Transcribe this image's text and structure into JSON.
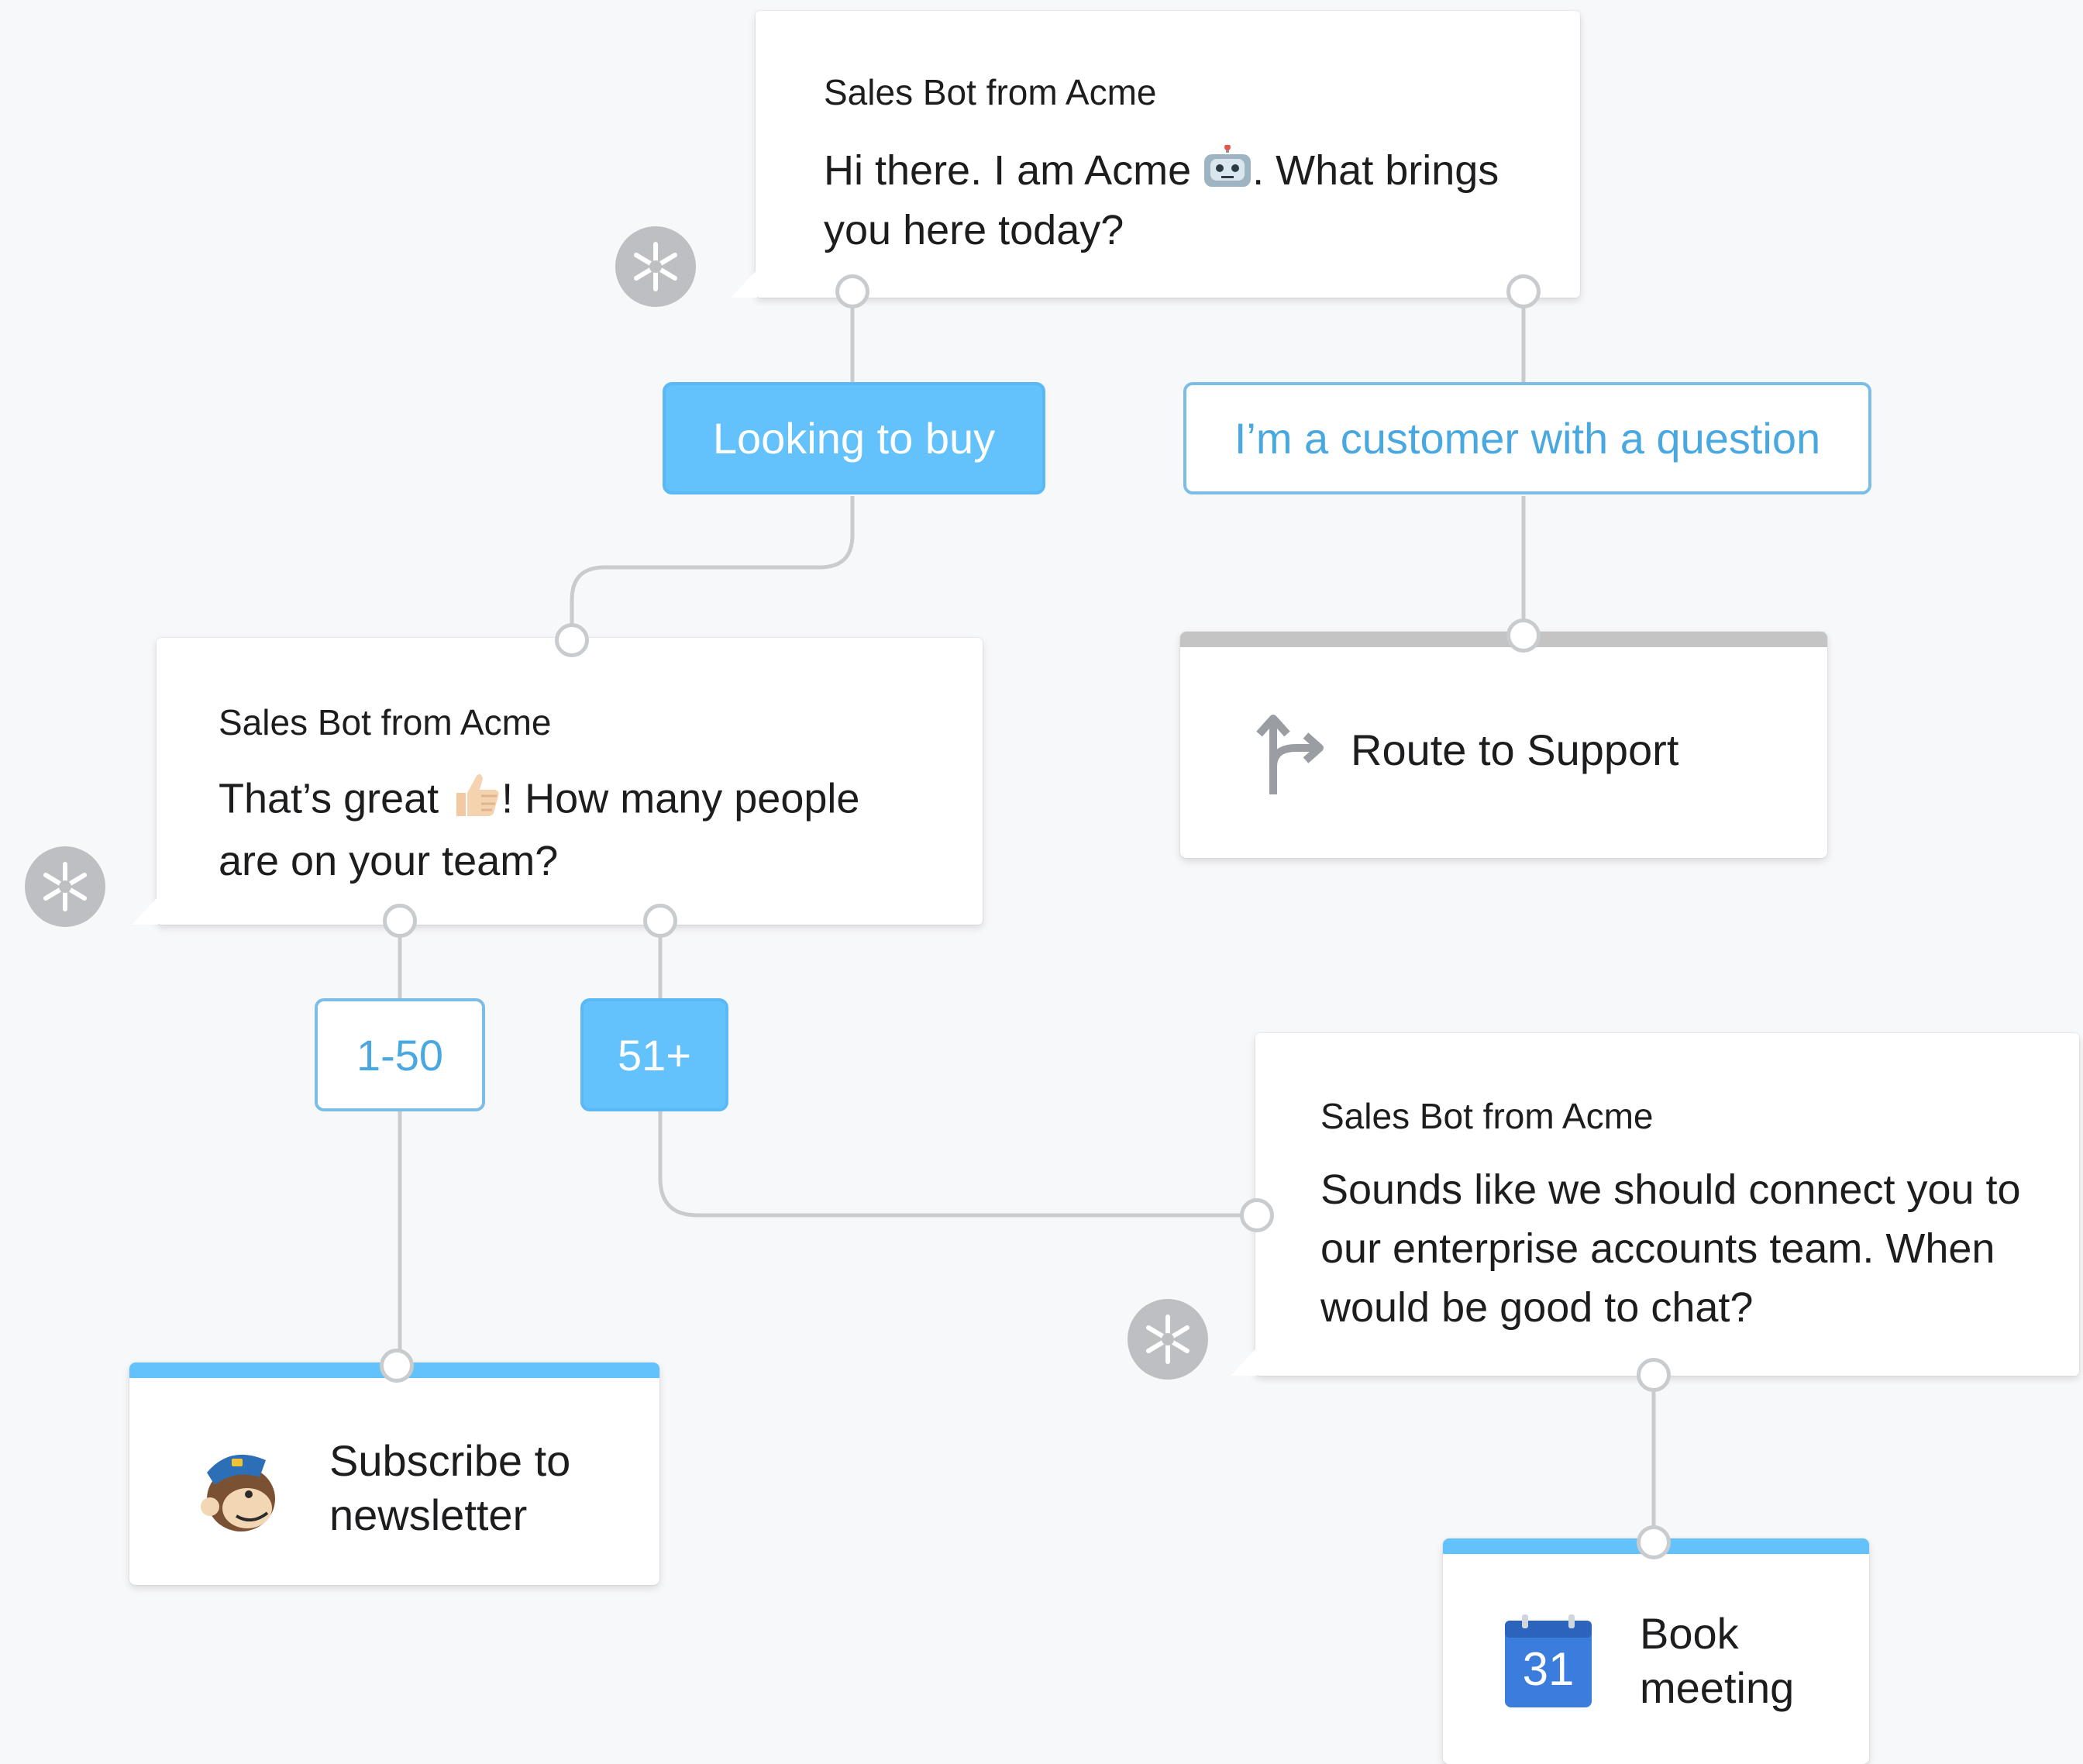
{
  "colors": {
    "background": "#f7f8fa",
    "chip_fill": "#63c1fb",
    "chip_outline": "#7cbde8",
    "connector": "#c9cccf",
    "action_bar_blue": "#63c1fb",
    "action_bar_grey": "#c4c4c4"
  },
  "nodes": {
    "greeting": {
      "from": "Sales Bot from Acme",
      "msg_line1_a": "Hi there. I am Acme ",
      "msg_line1_b": ". What brings",
      "msg_line2": "you here today?",
      "emoji": "robot-face-icon"
    },
    "team_size": {
      "from": "Sales Bot from Acme",
      "msg_line1_a": "That’s great ",
      "msg_line1_b": "! How many people",
      "msg_line2": "are on your team?",
      "emoji": "thumbs-up-icon"
    },
    "enterprise": {
      "from": "Sales Bot from Acme",
      "msg_line1": "Sounds like we should connect you to",
      "msg_line2": "our enterprise accounts team. When",
      "msg_line3": "would be good to chat?"
    }
  },
  "options": {
    "looking_to_buy": "Looking to buy",
    "customer_question": "I’m a customer with a question",
    "range_small": "1-50",
    "range_large": "51+"
  },
  "actions": {
    "route_support": {
      "label": "Route to Support",
      "icon": "route-arrow-icon"
    },
    "subscribe": {
      "label_line1": "Subscribe to",
      "label_line2": "newsletter",
      "icon": "mailchimp-icon"
    },
    "book": {
      "label_line1": "Book",
      "label_line2": "meeting",
      "icon": "calendar-icon",
      "calendar_day": "31"
    }
  }
}
